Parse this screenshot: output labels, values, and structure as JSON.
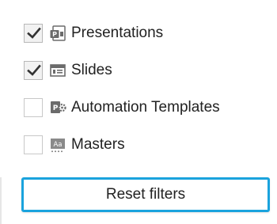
{
  "filters": {
    "items": [
      {
        "label": "Presentations",
        "checked": true,
        "icon": "presentation-file-icon"
      },
      {
        "label": "Slides",
        "checked": true,
        "icon": "slide-icon"
      },
      {
        "label": "Automation Templates",
        "checked": false,
        "icon": "automation-template-icon"
      },
      {
        "label": "Masters",
        "checked": false,
        "icon": "master-slide-icon"
      }
    ]
  },
  "actions": {
    "reset_label": "Reset filters"
  },
  "colors": {
    "accent": "#1aa3dd",
    "checkbox_border": "#c8c8c8",
    "text": "#222222",
    "icon_gray": "#6b6b6b"
  }
}
